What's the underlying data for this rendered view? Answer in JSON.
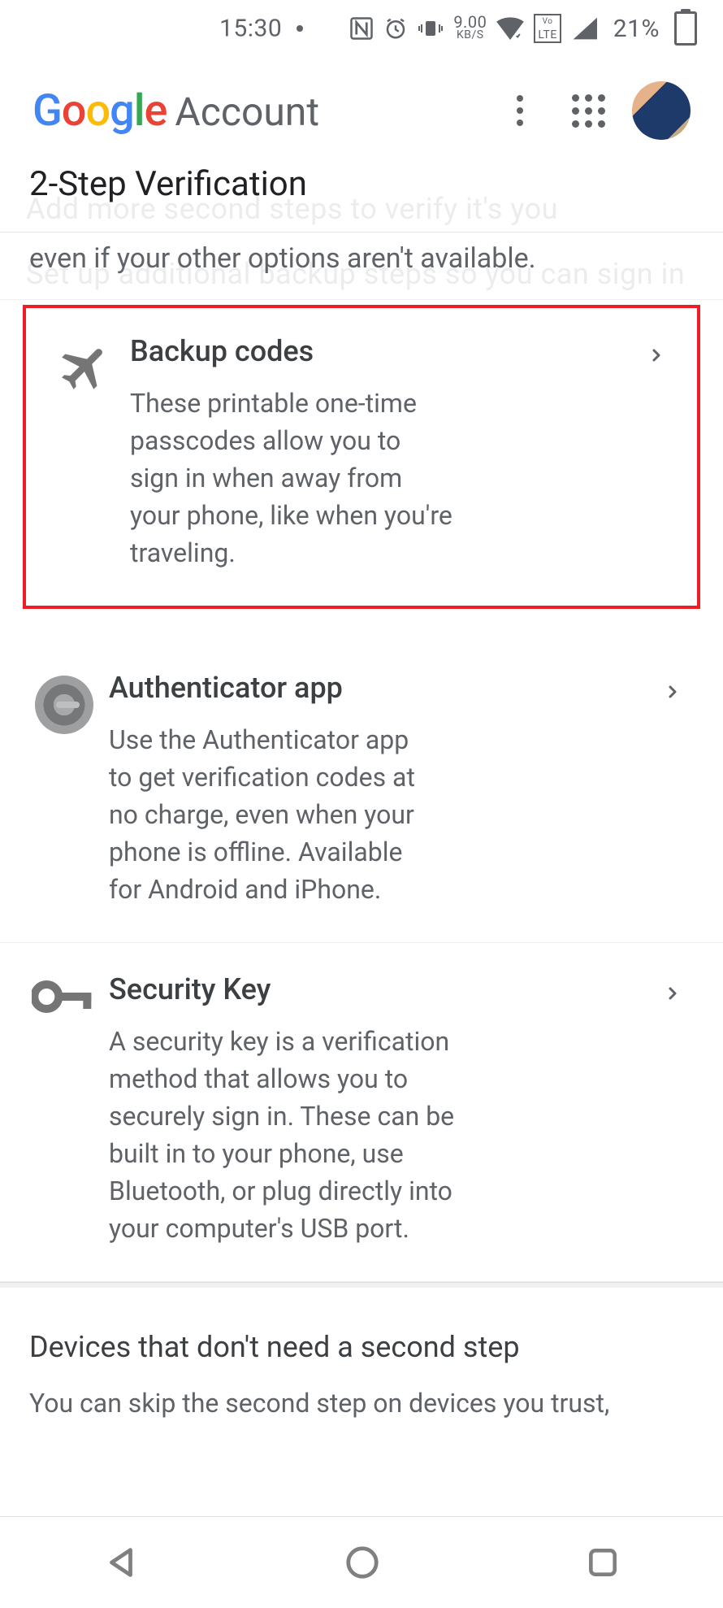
{
  "status_bar": {
    "time": "15:30",
    "kbs_top": "9.00",
    "kbs_bot": "KB/S",
    "lte_top": "Vo",
    "lte_bot": "LTE",
    "battery_pct": "21%"
  },
  "header": {
    "brand_account": "Account",
    "logo_letters": [
      "G",
      "o",
      "o",
      "g",
      "l",
      "e"
    ]
  },
  "ghost": {
    "l1": "Add more second steps to verify it's you",
    "l2": "Set up additional backup steps so you can sign in"
  },
  "subheader": {
    "title": "2-Step Verification"
  },
  "intro": {
    "text": "even if your other options aren't available."
  },
  "options": {
    "backup_codes": {
      "title": "Backup codes",
      "desc": "These printable one-time passcodes allow you to sign in when away from your phone, like when you're traveling."
    },
    "authenticator": {
      "title": "Authenticator app",
      "desc": "Use the Authenticator app to get verification codes at no charge, even when your phone is offline. Available for Android and iPhone."
    },
    "security_key": {
      "title": "Security Key",
      "desc": "A security key is a verification method that allows you to securely sign in. These can be built in to your phone, use Bluetooth, or plug directly into your computer's USB port."
    }
  },
  "devices": {
    "title": "Devices that don't need a second step",
    "body": "You can skip the second step on devices you trust,"
  }
}
